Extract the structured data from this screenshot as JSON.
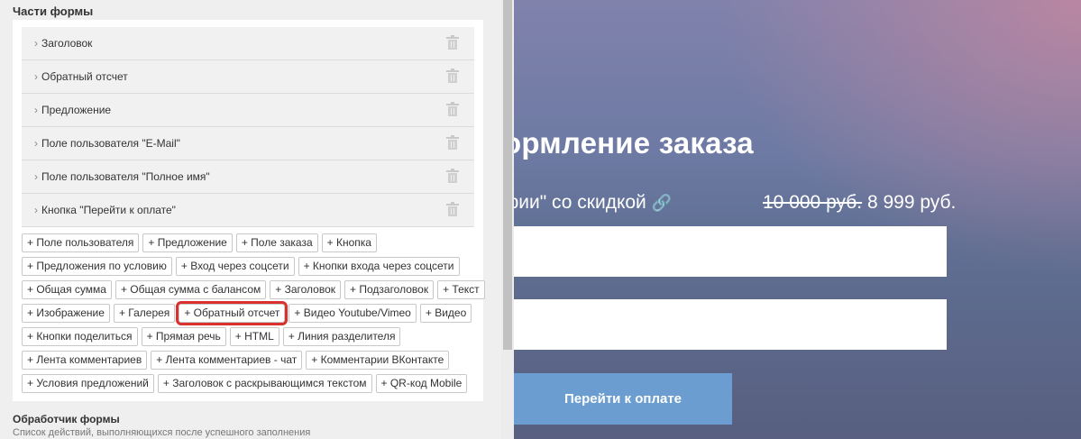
{
  "panel": {
    "section_title": "Части формы",
    "parts": [
      "Заголовок",
      "Обратный отсчет",
      "Предложение",
      "Поле пользователя \"E-Mail\"",
      "Поле пользователя \"Полное имя\"",
      "Кнопка \"Перейти к оплате\""
    ],
    "chip_rows": [
      [
        "+ Поле пользователя",
        "+ Предложение",
        "+ Поле заказа",
        "+ Кнопка"
      ],
      [
        "+ Предложения по условию",
        "+ Вход через соцсети",
        "+ Кнопки входа через соцсети"
      ],
      [
        "+ Общая сумма",
        "+ Общая сумма с балансом",
        "+ Заголовок",
        "+ Подзаголовок",
        "+ Текст"
      ],
      [
        "+ Изображение",
        "+ Галерея",
        "+ Обратный отсчет",
        "+ Видео Youtube/Vimeo",
        "+ Видео"
      ],
      [
        "+ Кнопки поделиться",
        "+ Прямая речь",
        "+ HTML",
        "+ Линия разделителя"
      ],
      [
        "+ Лента комментариев",
        "+ Лента комментариев - чат",
        "+ Комментарии ВКонтакте"
      ],
      [
        "+ Условия предложений",
        "+ Заголовок с раскрывающимся текстом",
        "+ QR-код Mobile"
      ]
    ],
    "highlighted_chip": "+ Обратный отсчет",
    "handler_title": "Обработчик формы",
    "handler_subtitle": "Список действий, выполняющихся после успешного заполнения"
  },
  "preview": {
    "title": "ормление заказа",
    "offer_text": "фии\" со скидкой",
    "old_price": "10 000 руб.",
    "new_price": " 8 999 руб.",
    "pay_button": "Перейти к оплате"
  },
  "colors": {
    "highlight": "#d9322e",
    "pay_button": "#6b9dd0"
  }
}
